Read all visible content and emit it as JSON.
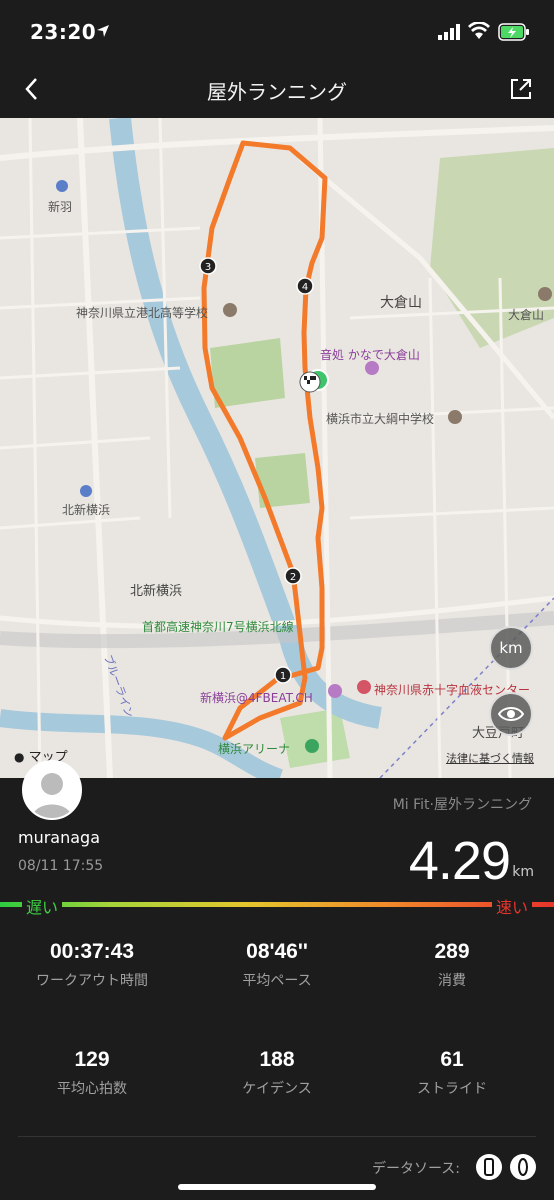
{
  "status_bar": {
    "time": "23:20"
  },
  "nav": {
    "title": "屋外ランニング"
  },
  "map": {
    "labels": {
      "shinyoko": "新羽",
      "kitashinyokohama_station": "北新横浜",
      "kitashinyokohama_area": "北新横浜",
      "kanagawa_school": "神奈川県立港北高等学校",
      "okurayama": "大倉山",
      "okurayama_partial": "大倉山",
      "kanade": "音処 かなで大倉山",
      "okurayama_junior": "横浜市立大綱中学校",
      "expressway": "首都高速神奈川7号横浜北線",
      "blue_line": "ブルーライン",
      "beat": "新横浜@4FBEAT.CH",
      "red_cross": "神奈川県赤十字血液センター",
      "arena": "横浜アリーナ",
      "otomachi": "大豆戸町"
    },
    "markers": [
      "1",
      "2",
      "3",
      "4"
    ],
    "km_button": "km",
    "apple_maps": "マップ",
    "legal": "法律に基づく情報"
  },
  "workout": {
    "username": "muranaga",
    "datetime": "08/11 17:55",
    "source_app": "Mi Fit·屋外ランニング",
    "distance": "4.29",
    "distance_unit": "km",
    "pace_slow": "遅い",
    "pace_fast": "速い",
    "stats": [
      {
        "value": "00:37:43",
        "label": "ワークアウト時間"
      },
      {
        "value": "08'46''",
        "label": "平均ペース"
      },
      {
        "value": "289",
        "label": "消費"
      },
      {
        "value": "129",
        "label": "平均心拍数"
      },
      {
        "value": "188",
        "label": "ケイデンス"
      },
      {
        "value": "61",
        "label": "ストライド"
      }
    ],
    "data_source_label": "データソース:"
  },
  "colors": {
    "route": "#f27a2a",
    "background": "#1c1c1c",
    "map_bg": "#e9e6e1"
  }
}
